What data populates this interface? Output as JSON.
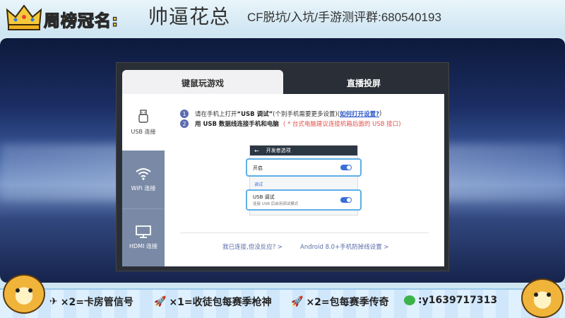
{
  "banner": {
    "weekly_title": "周榜冠名:",
    "streamer": "帅逼花总",
    "group_info": "CF脱坑/入坑/手游测评群:680540193"
  },
  "dialog": {
    "tabs": [
      {
        "label": "键鼠玩游戏",
        "active": true
      },
      {
        "label": "直播投屏",
        "active": false
      }
    ],
    "sidebar": [
      {
        "label": "USB 连接",
        "icon": "usb-icon",
        "active": true
      },
      {
        "label": "WiFi 连接",
        "icon": "wifi-icon",
        "active": false
      },
      {
        "label": "HDMI 连接",
        "icon": "monitor-icon",
        "active": false
      }
    ],
    "steps": [
      {
        "num": "1",
        "pre": "请在手机上打开",
        "bold": "“USB 调试”",
        "post": "(个别手机需要更多设置)(",
        "link": "如何打开设置?",
        "end": ")"
      },
      {
        "num": "2",
        "bold": "用 USB 数据线连接手机和电脑",
        "note": "( * 台式电脑建议连接机箱后面的 USB 接口)"
      }
    ],
    "phone": {
      "header": "开发者选项",
      "back_arrow": "←",
      "row_on": "开启",
      "section": "调试",
      "row_usb": "USB 调试",
      "row_usb_sub": "连接 USB 后启用调试模式"
    },
    "footer": {
      "link1": "我已连接,但没反应? >",
      "link2": "Android 8.0+手机防掉线设置 >"
    }
  },
  "gifts": {
    "g1": "×2=卡房管信号",
    "g2": "×1=收徒包每赛季枪神",
    "g3": "×2=包每赛季传奇",
    "g4": ":y1639717313"
  },
  "colors": {
    "accent": "#5b6bb0",
    "link": "#2a55c8",
    "note": "#e0514a",
    "highlight": "#5db0e8",
    "sidebar_inactive": "#7a8aa6"
  }
}
